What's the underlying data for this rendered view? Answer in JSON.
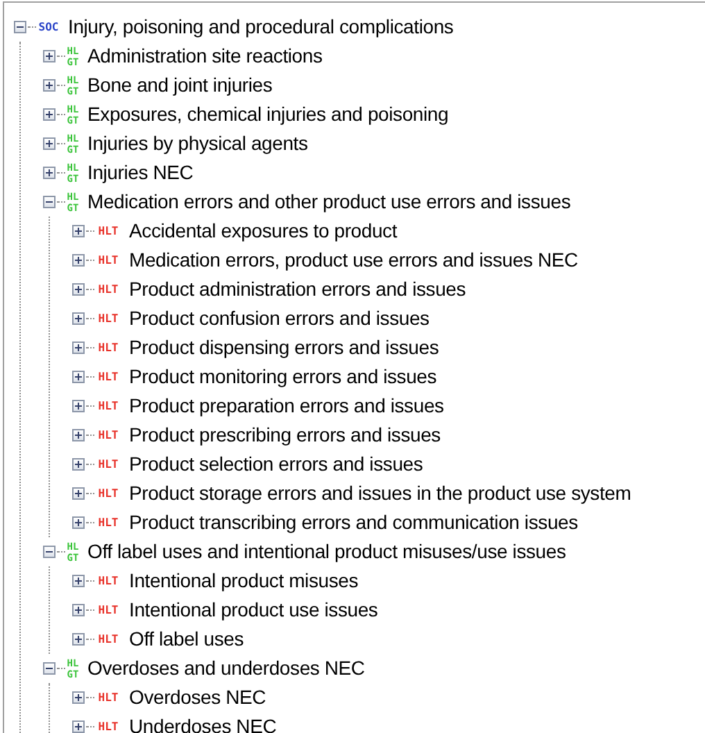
{
  "tree": [
    {
      "kind": "soc",
      "badge": [
        "SOC"
      ],
      "label": "Injury, poisoning and procedural complications",
      "expanded": true,
      "children": [
        {
          "kind": "hlgt",
          "badge": [
            "HL",
            "GT"
          ],
          "label": "Administration site reactions",
          "expanded": false
        },
        {
          "kind": "hlgt",
          "badge": [
            "HL",
            "GT"
          ],
          "label": "Bone and joint injuries",
          "expanded": false
        },
        {
          "kind": "hlgt",
          "badge": [
            "HL",
            "GT"
          ],
          "label": "Exposures, chemical injuries and poisoning",
          "expanded": false
        },
        {
          "kind": "hlgt",
          "badge": [
            "HL",
            "GT"
          ],
          "label": "Injuries by physical agents",
          "expanded": false
        },
        {
          "kind": "hlgt",
          "badge": [
            "HL",
            "GT"
          ],
          "label": "Injuries NEC",
          "expanded": false
        },
        {
          "kind": "hlgt",
          "badge": [
            "HL",
            "GT"
          ],
          "label": "Medication errors and other product use errors and issues",
          "expanded": true,
          "children": [
            {
              "kind": "hlt",
              "badge": [
                "HLT"
              ],
              "label": "Accidental exposures to product",
              "expanded": false
            },
            {
              "kind": "hlt",
              "badge": [
                "HLT"
              ],
              "label": "Medication errors, product use errors and issues NEC",
              "expanded": false
            },
            {
              "kind": "hlt",
              "badge": [
                "HLT"
              ],
              "label": "Product administration errors and issues",
              "expanded": false
            },
            {
              "kind": "hlt",
              "badge": [
                "HLT"
              ],
              "label": "Product confusion errors and issues",
              "expanded": false
            },
            {
              "kind": "hlt",
              "badge": [
                "HLT"
              ],
              "label": "Product dispensing errors and issues",
              "expanded": false
            },
            {
              "kind": "hlt",
              "badge": [
                "HLT"
              ],
              "label": "Product monitoring errors and issues",
              "expanded": false
            },
            {
              "kind": "hlt",
              "badge": [
                "HLT"
              ],
              "label": "Product preparation errors and issues",
              "expanded": false
            },
            {
              "kind": "hlt",
              "badge": [
                "HLT"
              ],
              "label": "Product prescribing errors and issues",
              "expanded": false
            },
            {
              "kind": "hlt",
              "badge": [
                "HLT"
              ],
              "label": "Product selection errors and issues",
              "expanded": false
            },
            {
              "kind": "hlt",
              "badge": [
                "HLT"
              ],
              "label": "Product storage errors and issues in the product use system",
              "expanded": false
            },
            {
              "kind": "hlt",
              "badge": [
                "HLT"
              ],
              "label": "Product transcribing errors and communication issues",
              "expanded": false
            }
          ]
        },
        {
          "kind": "hlgt",
          "badge": [
            "HL",
            "GT"
          ],
          "label": "Off label uses and intentional product misuses/use issues",
          "expanded": true,
          "children": [
            {
              "kind": "hlt",
              "badge": [
                "HLT"
              ],
              "label": "Intentional product misuses",
              "expanded": false
            },
            {
              "kind": "hlt",
              "badge": [
                "HLT"
              ],
              "label": "Intentional product use issues",
              "expanded": false
            },
            {
              "kind": "hlt",
              "badge": [
                "HLT"
              ],
              "label": "Off label uses",
              "expanded": false
            }
          ]
        },
        {
          "kind": "hlgt",
          "badge": [
            "HL",
            "GT"
          ],
          "label": "Overdoses and underdoses NEC",
          "expanded": true,
          "children": [
            {
              "kind": "hlt",
              "badge": [
                "HLT"
              ],
              "label": "Overdoses NEC",
              "expanded": false
            },
            {
              "kind": "hlt",
              "badge": [
                "HLT"
              ],
              "label": "Underdoses NEC",
              "expanded": false
            }
          ]
        }
      ]
    }
  ]
}
